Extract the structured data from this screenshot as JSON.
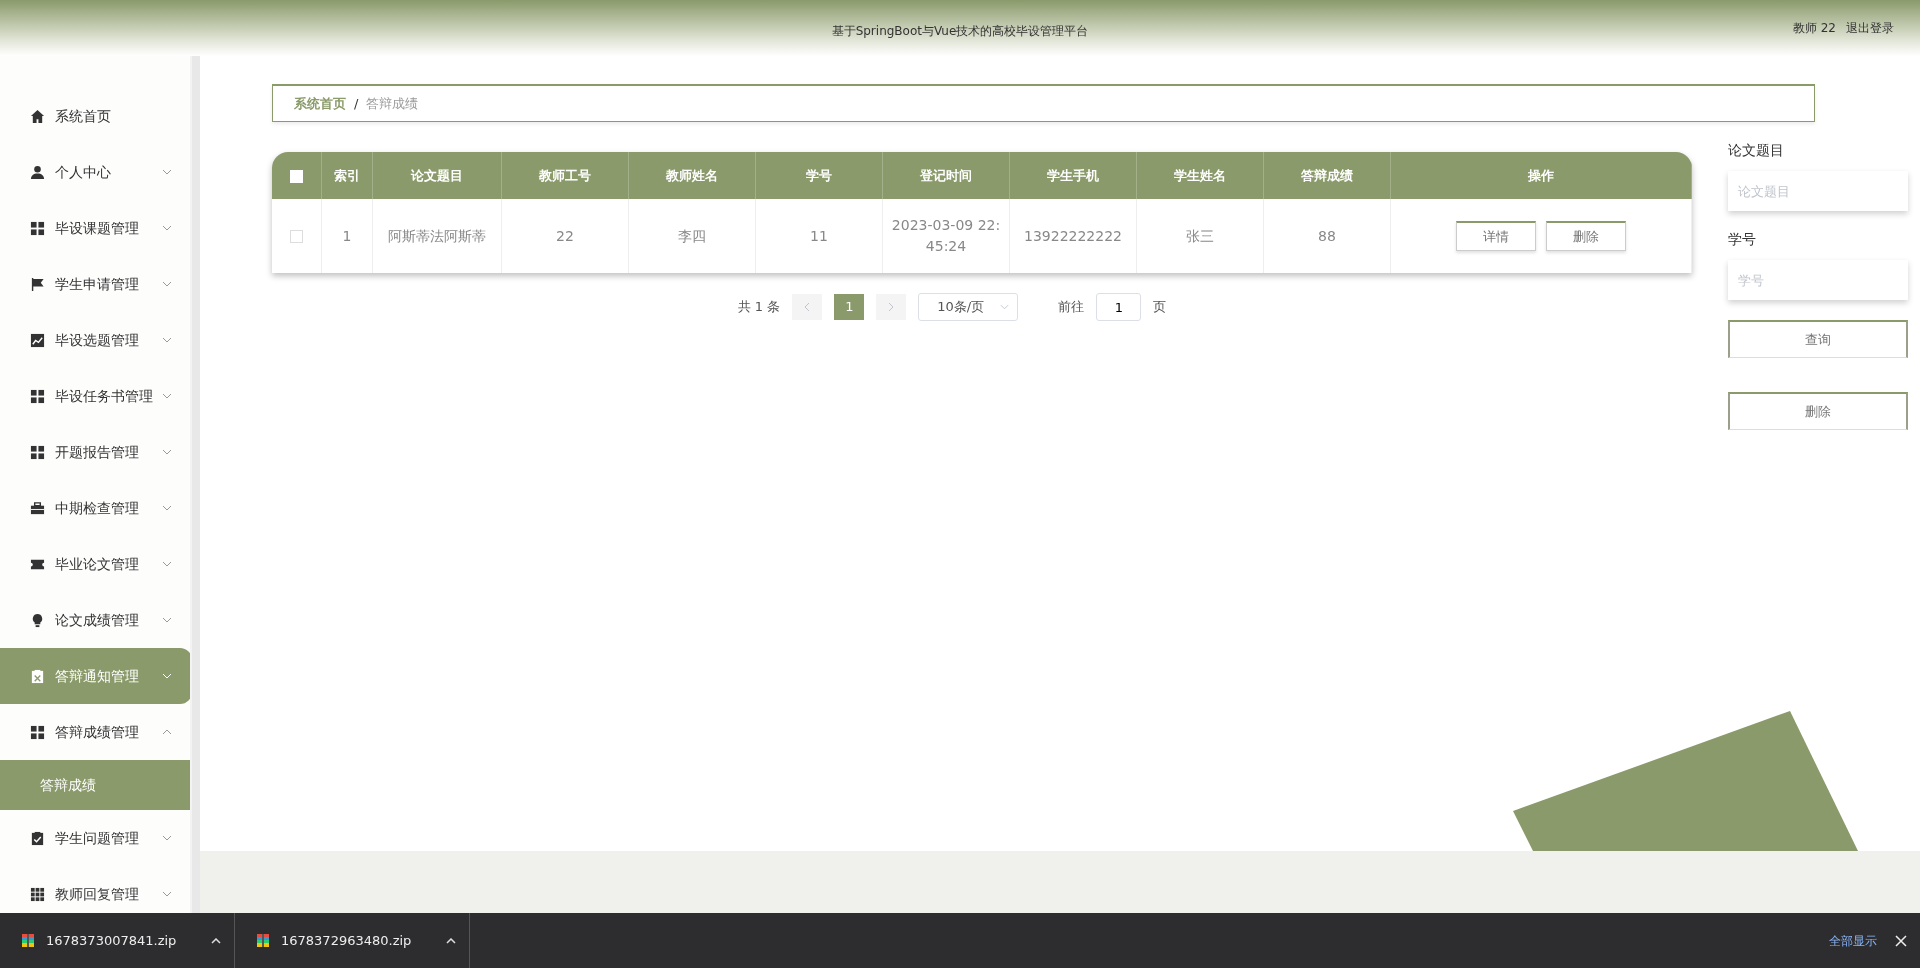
{
  "header": {
    "title": "基于SpringBoot与Vue技术的高校毕设管理平台",
    "user": "教师 22",
    "logout": "退出登录"
  },
  "sidebar": {
    "items": [
      {
        "label": "系统首页",
        "hovered": false
      },
      {
        "label": "个人中心",
        "expanded": false,
        "hovered": false
      },
      {
        "label": "毕设课题管理",
        "expanded": false,
        "hovered": false
      },
      {
        "label": "学生申请管理",
        "expanded": false,
        "hovered": false
      },
      {
        "label": "毕设选题管理",
        "expanded": false,
        "hovered": false
      },
      {
        "label": "毕设任务书管理",
        "expanded": false,
        "hovered": false
      },
      {
        "label": "开题报告管理",
        "expanded": false,
        "hovered": false
      },
      {
        "label": "中期检查管理",
        "expanded": false,
        "hovered": false
      },
      {
        "label": "毕业论文管理",
        "expanded": false,
        "hovered": false
      },
      {
        "label": "论文成绩管理",
        "expanded": false,
        "hovered": false
      },
      {
        "label": "答辩通知管理",
        "expanded": false,
        "hovered": true
      },
      {
        "label": "答辩成绩管理",
        "expanded": true,
        "hovered": false,
        "children": [
          {
            "label": "答辩成绩",
            "selected": true
          }
        ]
      },
      {
        "label": "学生问题管理",
        "expanded": false,
        "hovered": false
      },
      {
        "label": "教师回复管理",
        "expanded": false,
        "hovered": false
      }
    ]
  },
  "breadcrumb": {
    "separator": "/",
    "items": [
      {
        "label": "系统首页",
        "current": false
      },
      {
        "label": "答辩成绩",
        "current": true
      }
    ]
  },
  "table": {
    "select_all_checked": false,
    "columns": [
      "索引",
      "论文题目",
      "教师工号",
      "教师姓名",
      "学号",
      "登记时间",
      "学生手机",
      "学生姓名",
      "答辩成绩",
      "操作"
    ],
    "rows": [
      {
        "checked": false,
        "cells": [
          "1",
          "阿斯蒂法阿斯蒂",
          "22",
          "李四",
          "11",
          "2023-03-09 22:45:24",
          "13922222222",
          "张三",
          "88"
        ],
        "actions": [
          "详情",
          "删除"
        ]
      }
    ]
  },
  "pagination": {
    "total": "共 1 条",
    "pages": [
      {
        "label": "1",
        "selected": true
      }
    ],
    "page_size": "10条/页",
    "goto_label": "前往",
    "goto_value": "1",
    "page_unit": "页"
  },
  "search_panel": {
    "fields": [
      {
        "label": "论文题目",
        "placeholder": "论文题目"
      },
      {
        "label": "学号",
        "placeholder": "学号"
      }
    ],
    "buttons": [
      "查询",
      "删除"
    ]
  },
  "download_bar": {
    "items": [
      {
        "filename": "1678373007841.zip"
      },
      {
        "filename": "1678372963480.zip"
      }
    ],
    "show_all": "全部显示"
  }
}
